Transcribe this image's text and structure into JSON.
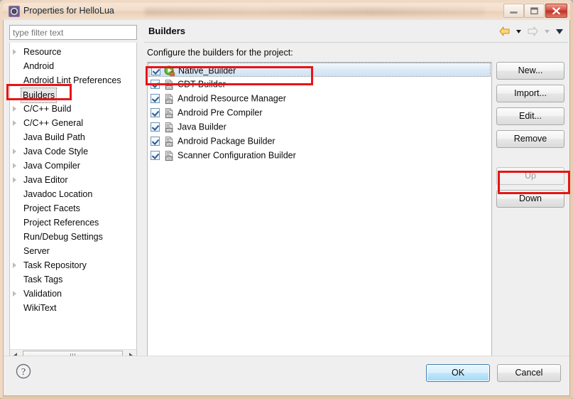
{
  "window": {
    "title": "Properties for HelloLua",
    "icon": "eclipse-properties-icon",
    "controls": {
      "minimize": "minimize-button",
      "maximize": "maximize-button",
      "close": "close-button"
    }
  },
  "filter": {
    "placeholder": "type filter text",
    "value": ""
  },
  "tree": {
    "items": [
      {
        "label": "Resource",
        "expandable": true,
        "selected": false
      },
      {
        "label": "Android",
        "expandable": false,
        "selected": false
      },
      {
        "label": "Android Lint Preferences",
        "expandable": false,
        "selected": false
      },
      {
        "label": "Builders",
        "expandable": false,
        "selected": true
      },
      {
        "label": "C/C++ Build",
        "expandable": true,
        "selected": false
      },
      {
        "label": "C/C++ General",
        "expandable": true,
        "selected": false
      },
      {
        "label": "Java Build Path",
        "expandable": false,
        "selected": false
      },
      {
        "label": "Java Code Style",
        "expandable": true,
        "selected": false
      },
      {
        "label": "Java Compiler",
        "expandable": true,
        "selected": false
      },
      {
        "label": "Java Editor",
        "expandable": true,
        "selected": false
      },
      {
        "label": "Javadoc Location",
        "expandable": false,
        "selected": false
      },
      {
        "label": "Project Facets",
        "expandable": false,
        "selected": false
      },
      {
        "label": "Project References",
        "expandable": false,
        "selected": false
      },
      {
        "label": "Run/Debug Settings",
        "expandable": false,
        "selected": false
      },
      {
        "label": "Server",
        "expandable": false,
        "selected": false
      },
      {
        "label": "Task Repository",
        "expandable": true,
        "selected": false
      },
      {
        "label": "Task Tags",
        "expandable": false,
        "selected": false
      },
      {
        "label": "Validation",
        "expandable": true,
        "selected": false
      },
      {
        "label": "WikiText",
        "expandable": false,
        "selected": false
      }
    ],
    "scrollbar": {
      "left_arrow": "scroll-left-arrow",
      "right_arrow": "scroll-right-arrow"
    }
  },
  "content": {
    "page_title": "Builders",
    "list_label": "Configure the builders for the project:",
    "nav": {
      "back": "back-arrow-icon",
      "back_menu": "back-dropdown-icon",
      "forward": "forward-arrow-icon",
      "forward_menu": "forward-dropdown-icon",
      "menu": "view-menu-icon"
    },
    "builders": [
      {
        "label": "Native_Builder",
        "checked": true,
        "selected": true,
        "icon": "run-external-tool-icon"
      },
      {
        "label": "CDT Builder",
        "checked": true,
        "selected": false,
        "icon": "builder-icon"
      },
      {
        "label": "Android Resource Manager",
        "checked": true,
        "selected": false,
        "icon": "builder-icon"
      },
      {
        "label": "Android Pre Compiler",
        "checked": true,
        "selected": false,
        "icon": "builder-icon"
      },
      {
        "label": "Java Builder",
        "checked": true,
        "selected": false,
        "icon": "builder-icon"
      },
      {
        "label": "Android Package Builder",
        "checked": true,
        "selected": false,
        "icon": "builder-icon"
      },
      {
        "label": "Scanner Configuration Builder",
        "checked": true,
        "selected": false,
        "icon": "builder-icon"
      }
    ],
    "side_buttons": [
      {
        "label": "New...",
        "enabled": true
      },
      {
        "label": "Import...",
        "enabled": true
      },
      {
        "label": "Edit...",
        "enabled": true
      },
      {
        "label": "Remove",
        "enabled": true
      },
      {
        "label": "Up",
        "enabled": false
      },
      {
        "label": "Down",
        "enabled": true
      }
    ]
  },
  "footer": {
    "help": "help-icon",
    "ok": "OK",
    "cancel": "Cancel"
  },
  "annotations": {
    "builders_tree_item": "red-highlight-box",
    "native_builder_row": "red-highlight-box",
    "up_button": "red-highlight-box"
  },
  "colors": {
    "annotation": "#e81414",
    "title_bar": "#f2dcc8",
    "selection": "#cfe2f4",
    "accent_ok": "#bee6fd"
  }
}
